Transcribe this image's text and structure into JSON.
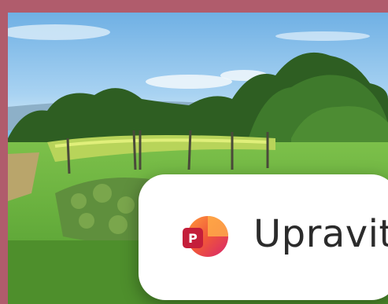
{
  "image": {
    "alt_subject": "vineyard"
  },
  "action": {
    "label": "Upravit",
    "icon": "powerpoint-app-icon",
    "icon_letter": "P"
  },
  "colors": {
    "frame_border": "#b05c6c",
    "ppt_orange": "#f36b3b",
    "ppt_magenta": "#d7266e",
    "ppt_red": "#c41e3a"
  }
}
